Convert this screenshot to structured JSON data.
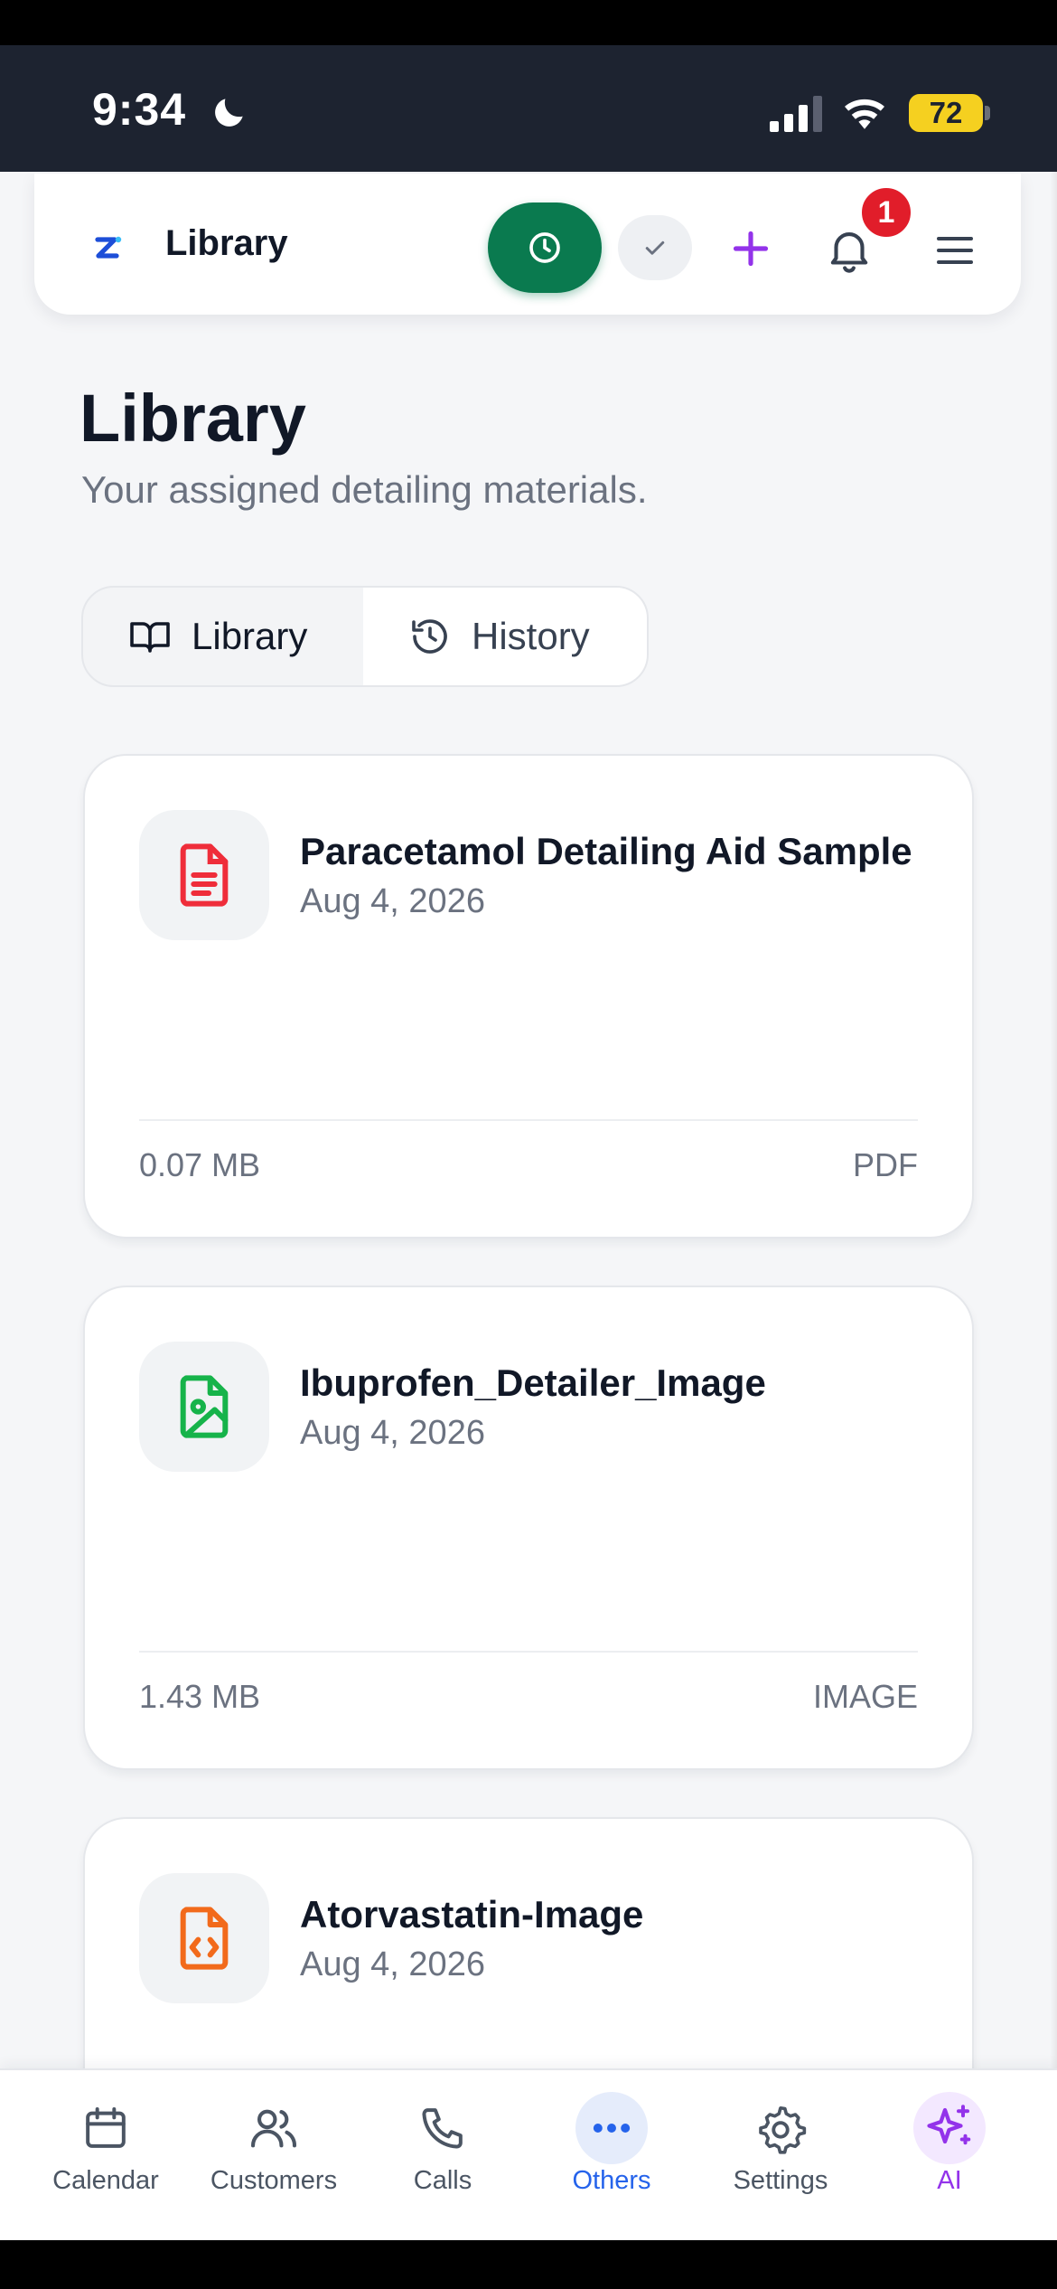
{
  "status_bar": {
    "time": "9:34",
    "battery": "72"
  },
  "header": {
    "title": "Library",
    "notification_count": "1"
  },
  "page": {
    "title": "Library",
    "subtitle": "Your assigned detailing materials."
  },
  "tabs": [
    {
      "label": "Library",
      "icon": "book-open-icon",
      "selected": true
    },
    {
      "label": "History",
      "icon": "history-icon",
      "selected": false
    }
  ],
  "files": [
    {
      "name": "Paracetamol Detailing Aid Sample",
      "date": "Aug 4, 2026",
      "size": "0.07 MB",
      "type": "PDF",
      "icon": "pdf-file-icon",
      "icon_color": "#ef2d3a"
    },
    {
      "name": "Ibuprofen_Detailer_Image",
      "date": "Aug 4, 2026",
      "size": "1.43 MB",
      "type": "IMAGE",
      "icon": "image-file-icon",
      "icon_color": "#16b34a"
    },
    {
      "name": "Atorvastatin-Image",
      "date": "Aug 4, 2026",
      "size": "",
      "type": "",
      "icon": "code-file-icon",
      "icon_color": "#f26a1b"
    }
  ],
  "bottom_nav": [
    {
      "label": "Calendar",
      "icon": "calendar-icon"
    },
    {
      "label": "Customers",
      "icon": "users-icon"
    },
    {
      "label": "Calls",
      "icon": "phone-icon"
    },
    {
      "label": "Others",
      "icon": "more-horizontal-icon",
      "active": true
    },
    {
      "label": "Settings",
      "icon": "gear-icon"
    },
    {
      "label": "AI",
      "icon": "sparkles-icon"
    }
  ],
  "colors": {
    "primary_green": "#0a7a4f",
    "accent_purple": "#9333ea",
    "active_blue": "#2563eb",
    "badge_red": "#e11d2a"
  }
}
